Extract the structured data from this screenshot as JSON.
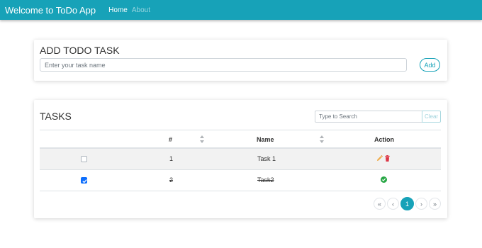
{
  "nav": {
    "brand": "Welcome to ToDo App",
    "links": [
      {
        "label": "Home",
        "active": true
      },
      {
        "label": "About",
        "active": false
      }
    ]
  },
  "add_task": {
    "title": "ADD TODO TASK",
    "input_placeholder": "Enter your task name",
    "input_value": "",
    "add_label": "Add"
  },
  "tasks": {
    "title": "TASKS",
    "search_placeholder": "Type to Search",
    "clear_label": "Clear",
    "columns": [
      "",
      "#",
      "Name",
      "Action"
    ],
    "rows": [
      {
        "checked": false,
        "id": "1",
        "name": "Task 1",
        "actions": [
          "edit-icon",
          "delete-icon"
        ]
      },
      {
        "checked": true,
        "id": "2",
        "name": "Task2",
        "actions": [
          "check-circle-icon"
        ]
      }
    ],
    "pagination": {
      "first": "«",
      "prev": "‹",
      "current": "1",
      "next": "›",
      "last": "»"
    }
  },
  "colors": {
    "primary": "#17a2b8",
    "edit": "#f0ad4e",
    "delete": "#dc3545",
    "done": "#28a745",
    "checkbox": "#0d6efd"
  }
}
